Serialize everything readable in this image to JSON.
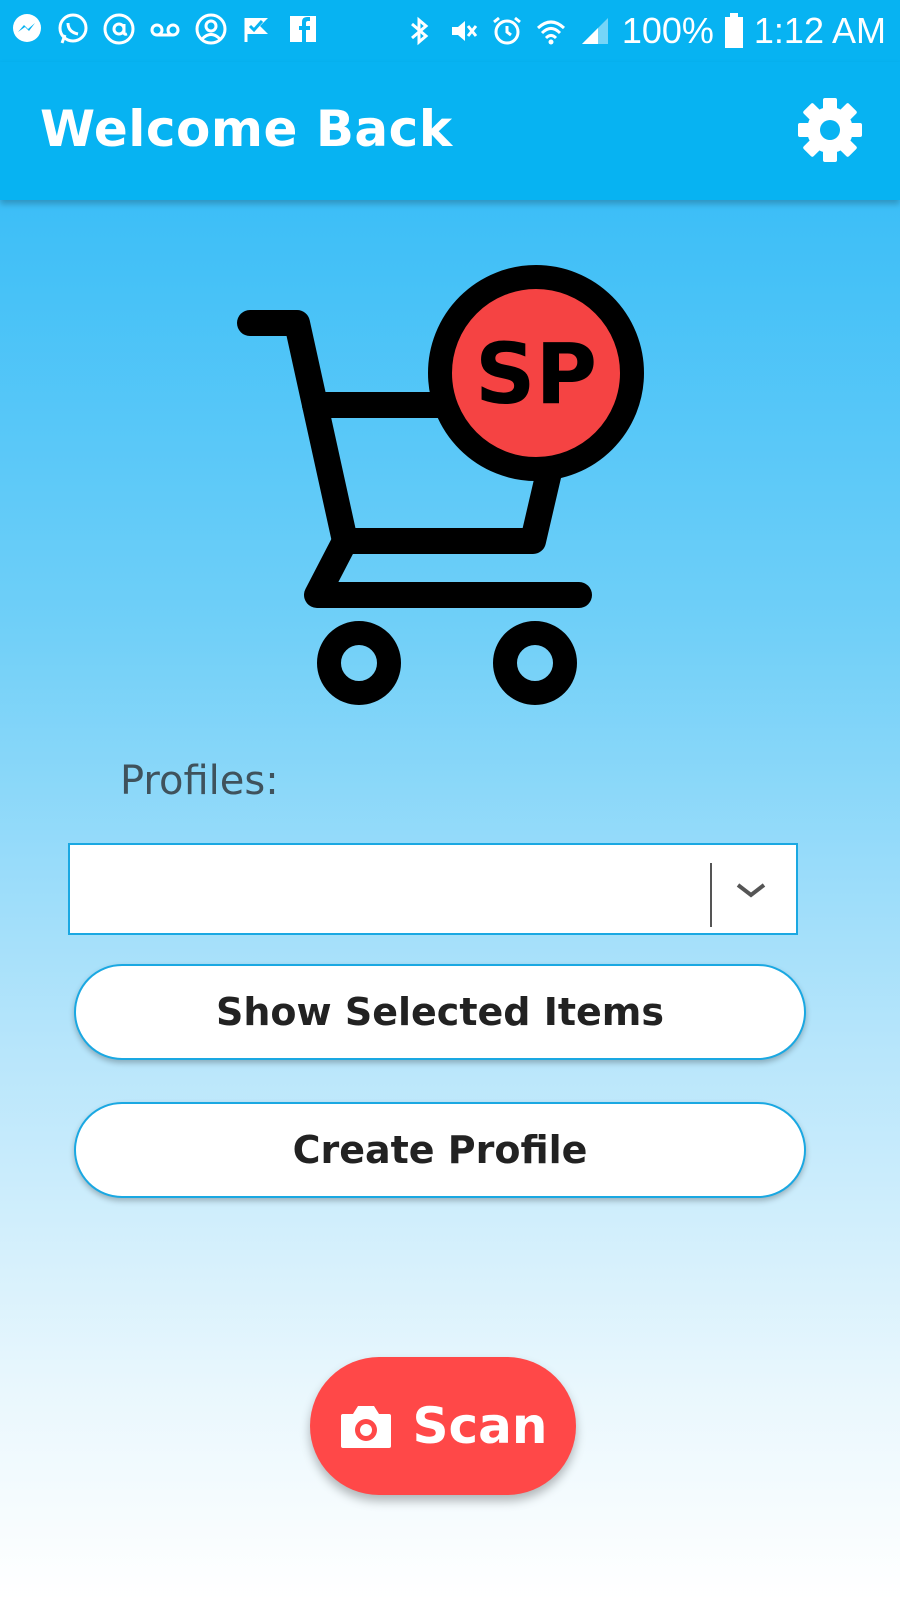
{
  "status_bar": {
    "notification_icons": [
      "messenger-icon",
      "whatsapp-icon",
      "at-sign-icon",
      "voicemail-icon",
      "account-circle-icon",
      "check-flag-icon",
      "facebook-icon"
    ],
    "system_icons": [
      "bluetooth-icon",
      "vibrate-mute-icon",
      "alarm-icon",
      "wifi-icon",
      "signal-icon",
      "battery-icon"
    ],
    "battery": "100%",
    "time": "1:12 AM"
  },
  "app_bar": {
    "title": "Welcome Back",
    "settings_icon": "gear-icon"
  },
  "logo": {
    "badge_text": "SP"
  },
  "profiles": {
    "label": "Profiles:",
    "selected_value": ""
  },
  "buttons": {
    "show_selected_items": "Show Selected Items",
    "create_profile": "Create Profile",
    "scan": "Scan"
  },
  "colors": {
    "app_bar": "#07b3f2",
    "accent_border": "#1aa8e2",
    "scan_button": "#ff4848",
    "logo_badge": "#f54343"
  }
}
